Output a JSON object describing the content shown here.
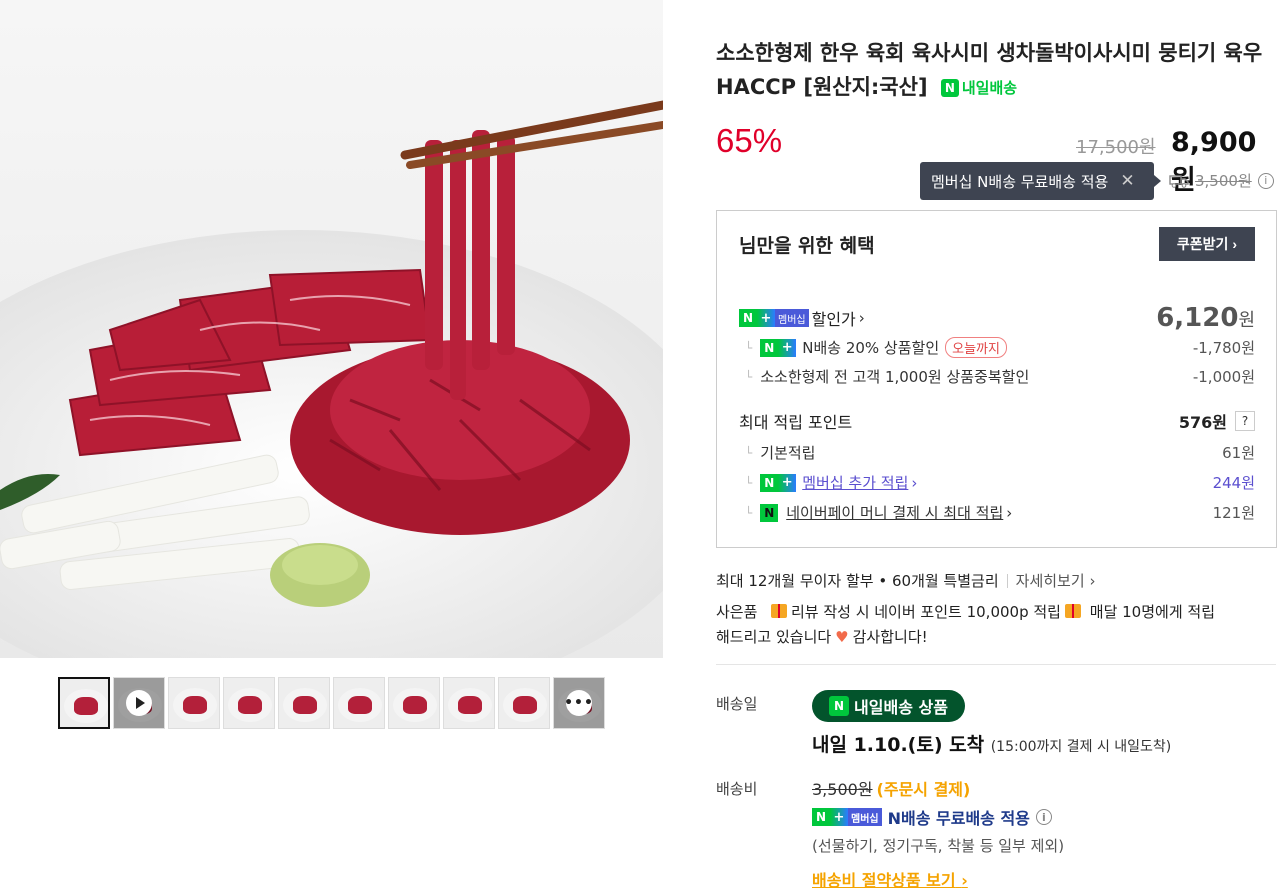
{
  "product": {
    "title": "소소한형제 한우 육회 육사시미 생차돌박이사시미 뭉티기 육우 HACCP [원산지:국산]",
    "delivery_badge": "내일배송",
    "discount_rate": "65%",
    "original_price": "17,500원",
    "sale_price": "8,900원"
  },
  "tooltip": {
    "text": "멤버십 N배송 무료배송 적용",
    "close": "✕"
  },
  "shipping_strike": {
    "amount": "3,500원"
  },
  "benefits": {
    "title": "님만을 위한 혜택",
    "coupon_button": "쿠폰받기",
    "membership_badge": "멤버십",
    "discount_label": "할인가",
    "discount_price": "6,120",
    "discount_unit": "원",
    "items": [
      {
        "label": "N배송 20% 상품할인",
        "pill": "오늘까지",
        "value": "-1,780원"
      },
      {
        "label": "소소한형제 전 고객 1,000원 상품중복할인",
        "value": "-1,000원"
      }
    ],
    "points_title": "최대 적립 포인트",
    "points_total": "576원",
    "points_help": "?",
    "points": [
      {
        "label": "기본적립",
        "value": "61원"
      },
      {
        "label": "멤버십 추가 적립",
        "value": "244원"
      },
      {
        "label": "네이버페이 머니 결제 시 최대 적립",
        "value": "121원"
      }
    ]
  },
  "installment": {
    "text": "최대 12개월 무이자 할부 • 60개월 특별금리",
    "more": "자세히보기"
  },
  "gift": {
    "prefix": "사은품",
    "text1": "리뷰 작성 시 네이버 포인트 10,000p 적립",
    "text2": "매달 10명에게 적립",
    "text3": "해드리고 있습니다",
    "text4": "감사합니다!"
  },
  "delivery": {
    "label_date": "배송일",
    "badge": "내일배송 상품",
    "arrive": "내일 1.10.(토) 도착",
    "arrive_note": "(15:00까지 결제 시 내일도착)",
    "label_fee": "배송비",
    "fee": "3,500원",
    "fee_note": "(주문시 결제)",
    "free_text": "N배송 무료배송 적용",
    "exclusion": "(선물하기, 정기구독, 착불 등 일부 제외)",
    "save_link": "배송비 절약상품 보기"
  },
  "icons": [
    "play-icon",
    "more-icon",
    "close-icon",
    "truck-icon",
    "info-icon",
    "chevron-right-icon",
    "gift-icon",
    "heart-icon"
  ],
  "colors": {
    "red": "#e0002a",
    "green": "#00c73c",
    "dark": "#3e4451",
    "deliv_green": "#03542c",
    "orange": "#f5a300"
  }
}
